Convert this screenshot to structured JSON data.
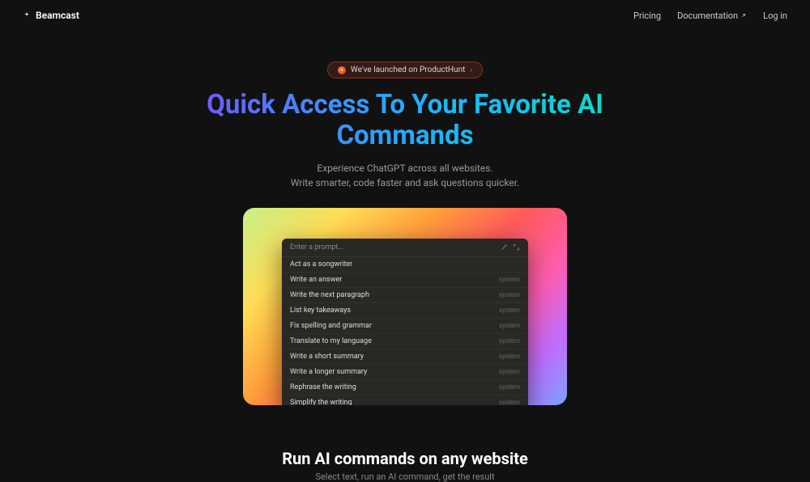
{
  "nav": {
    "brand": "Beamcast",
    "links": {
      "pricing": "Pricing",
      "docs": "Documentation",
      "login": "Log in"
    }
  },
  "badge": {
    "text": "We've launched on ProductHunt"
  },
  "hero": {
    "headline_line1": "Quick Access To Your Favorite AI",
    "headline_line2": "Commands",
    "sub_line1": "Experience ChatGPT across all websites.",
    "sub_line2": "Write smarter, code faster and ask questions quicker."
  },
  "palette": {
    "placeholder": "Enter a prompt...",
    "items": [
      {
        "label": "Act as a songwriter",
        "tag": ""
      },
      {
        "label": "Write an answer",
        "tag": "system"
      },
      {
        "label": "Write the next paragraph",
        "tag": "system"
      },
      {
        "label": "List key takeaways",
        "tag": "system"
      },
      {
        "label": "Fix spelling and grammar",
        "tag": "system"
      },
      {
        "label": "Translate to my language",
        "tag": "system"
      },
      {
        "label": "Write a short summary",
        "tag": "system"
      },
      {
        "label": "Write a longer summary",
        "tag": "system"
      },
      {
        "label": "Rephrase the writing",
        "tag": "system"
      },
      {
        "label": "Simplify the writing",
        "tag": "system"
      }
    ]
  },
  "section2": {
    "title": "Run AI commands on any website",
    "sub": "Select text, run an AI command, get the result"
  }
}
